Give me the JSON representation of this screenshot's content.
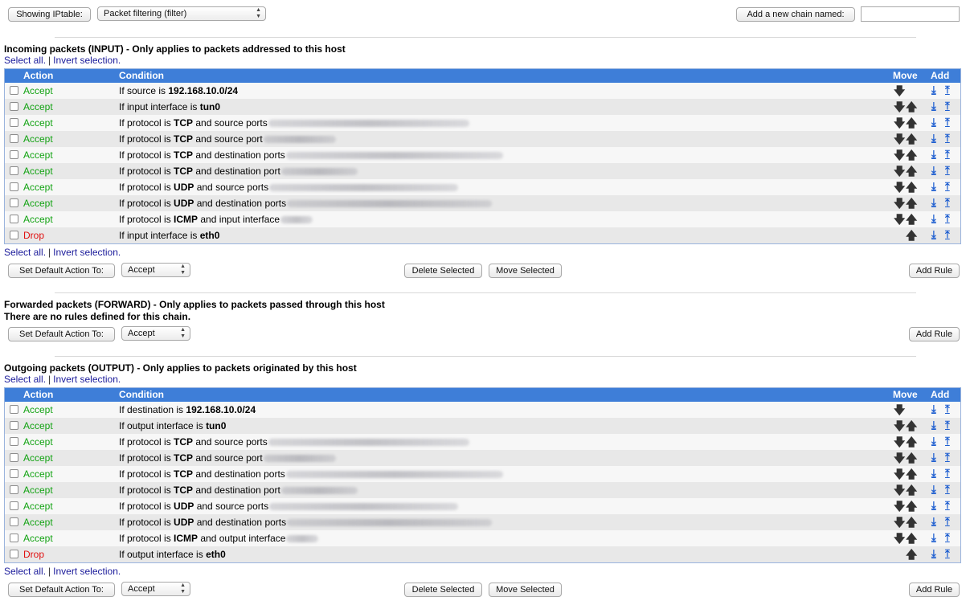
{
  "toolbar": {
    "showing_button": "Showing IPtable:",
    "table_select": "Packet filtering (filter)",
    "add_chain_button": "Add a new chain named:",
    "chain_name_value": ""
  },
  "common": {
    "select_all": "Select all.",
    "separator": "|",
    "invert": "Invert selection.",
    "col_action": "Action",
    "col_condition": "Condition",
    "col_move": "Move",
    "col_add": "Add",
    "set_default": "Set Default Action To:",
    "default_value": "Accept",
    "delete_selected": "Delete Selected",
    "move_selected": "Move Selected",
    "add_rule": "Add Rule",
    "icons": {
      "move_down": "arrow-down-icon",
      "move_up": "arrow-up-icon",
      "add_below": "add-below-icon",
      "add_above": "add-above-icon"
    }
  },
  "input": {
    "title": "Incoming packets (INPUT) - Only applies to packets addressed to this host",
    "rules": [
      {
        "action": "Accept",
        "pre": "If source is ",
        "bold": "192.168.10.0/24",
        "post": ""
      },
      {
        "action": "Accept",
        "pre": "If input interface is ",
        "bold": "tun0",
        "post": ""
      },
      {
        "action": "Accept",
        "pre": "If protocol is ",
        "bold": "TCP",
        "post": " and source ports"
      },
      {
        "action": "Accept",
        "pre": "If protocol is ",
        "bold": "TCP",
        "post": " and source port"
      },
      {
        "action": "Accept",
        "pre": "If protocol is ",
        "bold": "TCP",
        "post": " and destination ports"
      },
      {
        "action": "Accept",
        "pre": "If protocol is ",
        "bold": "TCP",
        "post": " and destination port"
      },
      {
        "action": "Accept",
        "pre": "If protocol is ",
        "bold": "UDP",
        "post": " and source ports"
      },
      {
        "action": "Accept",
        "pre": "If protocol is ",
        "bold": "UDP",
        "post": " and destination ports"
      },
      {
        "action": "Accept",
        "pre": "If protocol is ",
        "bold": "ICMP",
        "post": " and input interface"
      },
      {
        "action": "Drop",
        "pre": "If input interface is ",
        "bold": "eth0",
        "post": ""
      }
    ]
  },
  "forward": {
    "title": "Forwarded packets (FORWARD) - Only applies to packets passed through this host",
    "empty_note": "There are no rules defined for this chain."
  },
  "output": {
    "title": "Outgoing packets (OUTPUT) - Only applies to packets originated by this host",
    "rules": [
      {
        "action": "Accept",
        "pre": "If destination is ",
        "bold": "192.168.10.0/24",
        "post": ""
      },
      {
        "action": "Accept",
        "pre": "If output interface is ",
        "bold": "tun0",
        "post": ""
      },
      {
        "action": "Accept",
        "pre": "If protocol is ",
        "bold": "TCP",
        "post": " and source ports"
      },
      {
        "action": "Accept",
        "pre": "If protocol is ",
        "bold": "TCP",
        "post": " and source port"
      },
      {
        "action": "Accept",
        "pre": "If protocol is ",
        "bold": "TCP",
        "post": " and destination ports"
      },
      {
        "action": "Accept",
        "pre": "If protocol is ",
        "bold": "TCP",
        "post": " and destination port"
      },
      {
        "action": "Accept",
        "pre": "If protocol is ",
        "bold": "UDP",
        "post": " and source ports"
      },
      {
        "action": "Accept",
        "pre": "If protocol is ",
        "bold": "UDP",
        "post": " and destination ports"
      },
      {
        "action": "Accept",
        "pre": "If protocol is ",
        "bold": "ICMP",
        "post": " and output interface"
      },
      {
        "action": "Drop",
        "pre": "If output interface is ",
        "bold": "eth0",
        "post": ""
      }
    ]
  }
}
